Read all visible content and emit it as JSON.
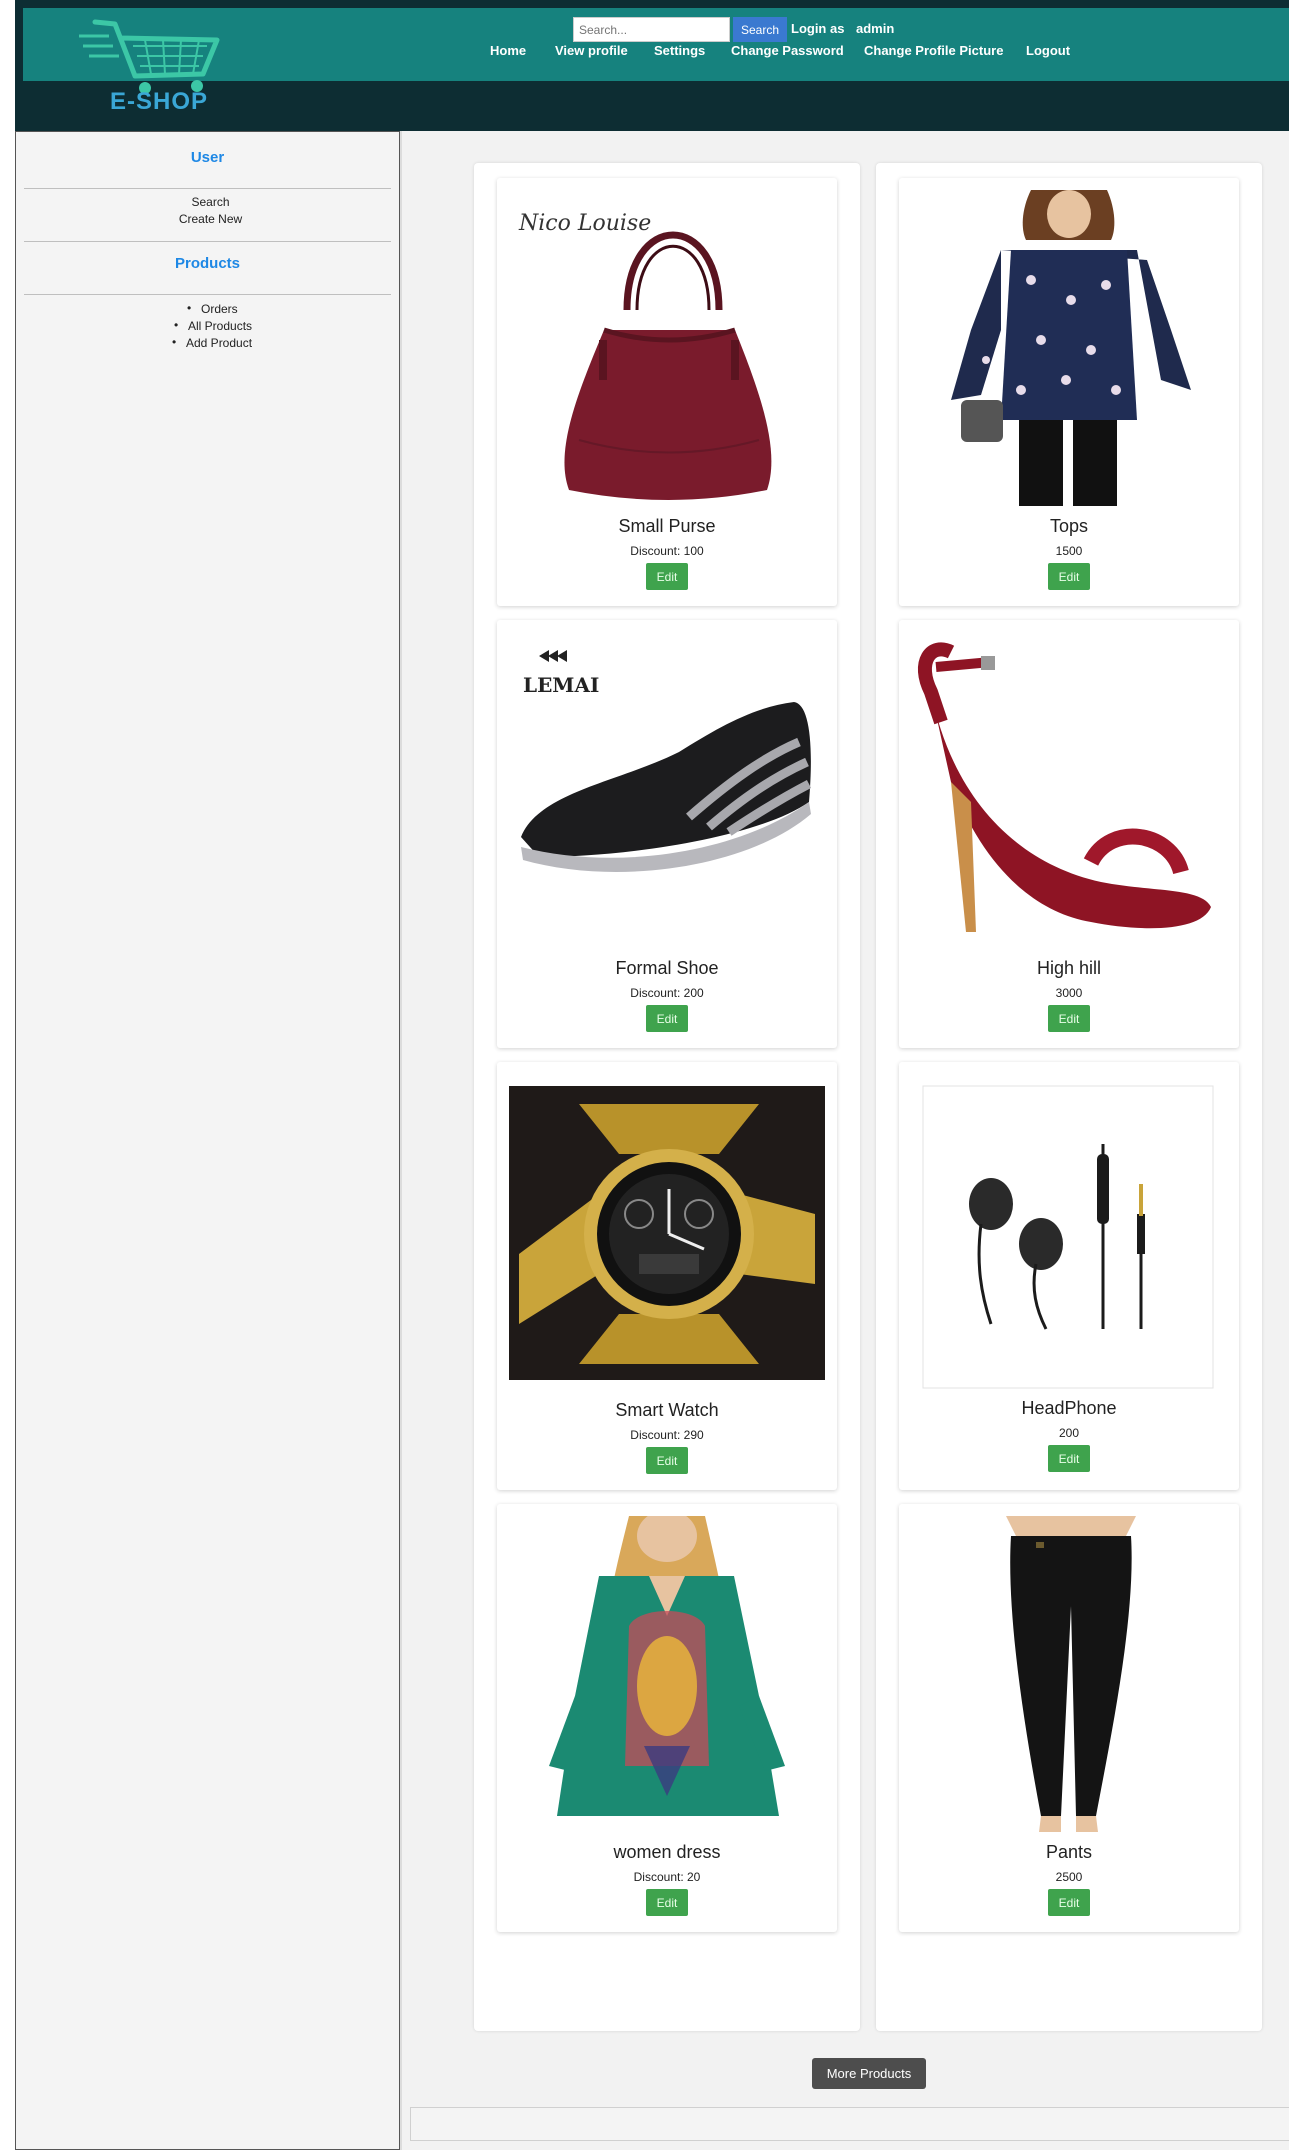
{
  "header": {
    "logo_text": "E-SHOP",
    "search": {
      "placeholder": "Search...",
      "button_label": "Search"
    },
    "login_label": "Login as",
    "login_user": "admin",
    "nav": [
      "Home",
      "View profile",
      "Settings",
      "Change Password",
      "Change Profile Picture",
      "Logout"
    ]
  },
  "sidebar": {
    "user_heading": "User",
    "user_links": [
      "Search",
      "Create New"
    ],
    "products_heading": "Products",
    "product_links": [
      "Orders",
      "All Products",
      "Add Product"
    ]
  },
  "products": [
    {
      "title": "Small Purse",
      "subtitle": "Discount: 100",
      "edit_label": "Edit",
      "icon": "purse-image"
    },
    {
      "title": "Tops",
      "subtitle": "1500",
      "edit_label": "Edit",
      "icon": "top-image"
    },
    {
      "title": "Formal Shoe",
      "subtitle": "Discount: 200",
      "edit_label": "Edit",
      "icon": "shoe-image",
      "brand_text": "LEMAI"
    },
    {
      "title": "High hill",
      "subtitle": "3000",
      "edit_label": "Edit",
      "icon": "heel-image"
    },
    {
      "title": "Smart Watch",
      "subtitle": "Discount: 290",
      "edit_label": "Edit",
      "icon": "watch-image"
    },
    {
      "title": "HeadPhone",
      "subtitle": "200",
      "edit_label": "Edit",
      "icon": "earphone-image"
    },
    {
      "title": "women dress",
      "subtitle": "Discount: 20",
      "edit_label": "Edit",
      "icon": "dress-image"
    },
    {
      "title": "Pants",
      "subtitle": "2500",
      "edit_label": "Edit",
      "icon": "pants-image"
    }
  ],
  "more_products_label": "More Products",
  "colors": {
    "header_bar": "#16827e",
    "header_dark": "#0d2d33",
    "edit_green": "#3fa34d",
    "accent_blue": "#1e88e5"
  }
}
